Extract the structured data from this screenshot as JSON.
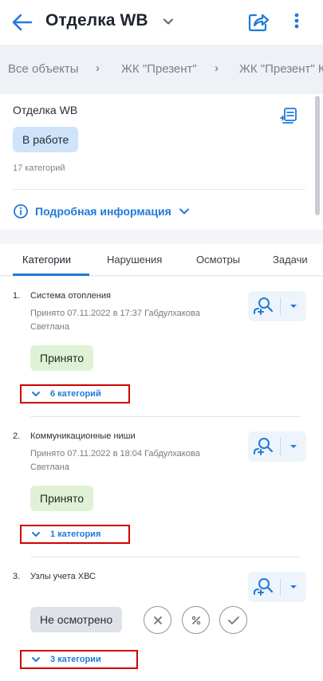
{
  "header": {
    "title": "Отделка WB"
  },
  "breadcrumb": {
    "items": [
      "Все объекты",
      "ЖК \"Презент\"",
      "ЖК \"Презент\" К"
    ]
  },
  "object": {
    "name": "Отделка WB",
    "status": "В работе",
    "category_count": "17 категорий",
    "details_label": "Подробная информация"
  },
  "tabs": [
    "Категории",
    "Нарушения",
    "Осмотры",
    "Задачи"
  ],
  "items": [
    {
      "number": "1.",
      "title": "Система отопления",
      "meta": "Принято 07.11.2022 в 17:37 Габдулхакова Светлана",
      "status": "Принято",
      "sub_link": "6 категорий"
    },
    {
      "number": "2.",
      "title": "Коммуникационные ниши",
      "meta": "Принято 07.11.2022 в 18:04 Габдулхакова Светлана",
      "status": "Принято",
      "sub_link": "1 категория"
    },
    {
      "number": "3.",
      "title": "Узлы учета ХВС",
      "status": "Не осмотрено",
      "sub_link": "3 категории"
    }
  ],
  "colors": {
    "accent": "#1f7ad9",
    "status_work": "#cfe4fb",
    "status_accepted": "#dff2d6",
    "status_pending": "#dfe2e7",
    "highlight": "#d10000"
  }
}
